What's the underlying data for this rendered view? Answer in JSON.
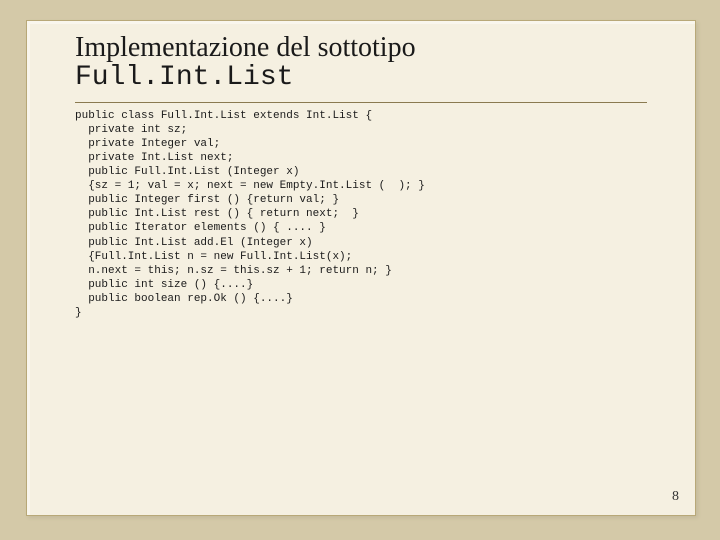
{
  "slide": {
    "title_line1": "Implementazione del sottotipo",
    "title_line2": "Full.Int.List",
    "page_number": "8"
  },
  "code": {
    "l01": "public class Full.Int.List extends Int.List {",
    "l02": "  private int sz;",
    "l03": "  private Integer val;",
    "l04": "  private Int.List next;",
    "l05": "  public Full.Int.List (Integer x)",
    "l06": "  {sz = 1; val = x; next = new Empty.Int.List (  ); }",
    "l07": "  public Integer first () {return val; }",
    "l08": "  public Int.List rest () { return next;  }",
    "l09": "  public Iterator elements () { .... }",
    "l10": "  public Int.List add.El (Integer x)",
    "l11": "  {Full.Int.List n = new Full.Int.List(x);",
    "l12": "  n.next = this; n.sz = this.sz + 1; return n; }",
    "l13": "  public int size () {....}",
    "l14": "  public boolean rep.Ok () {....}",
    "l15": "}"
  }
}
